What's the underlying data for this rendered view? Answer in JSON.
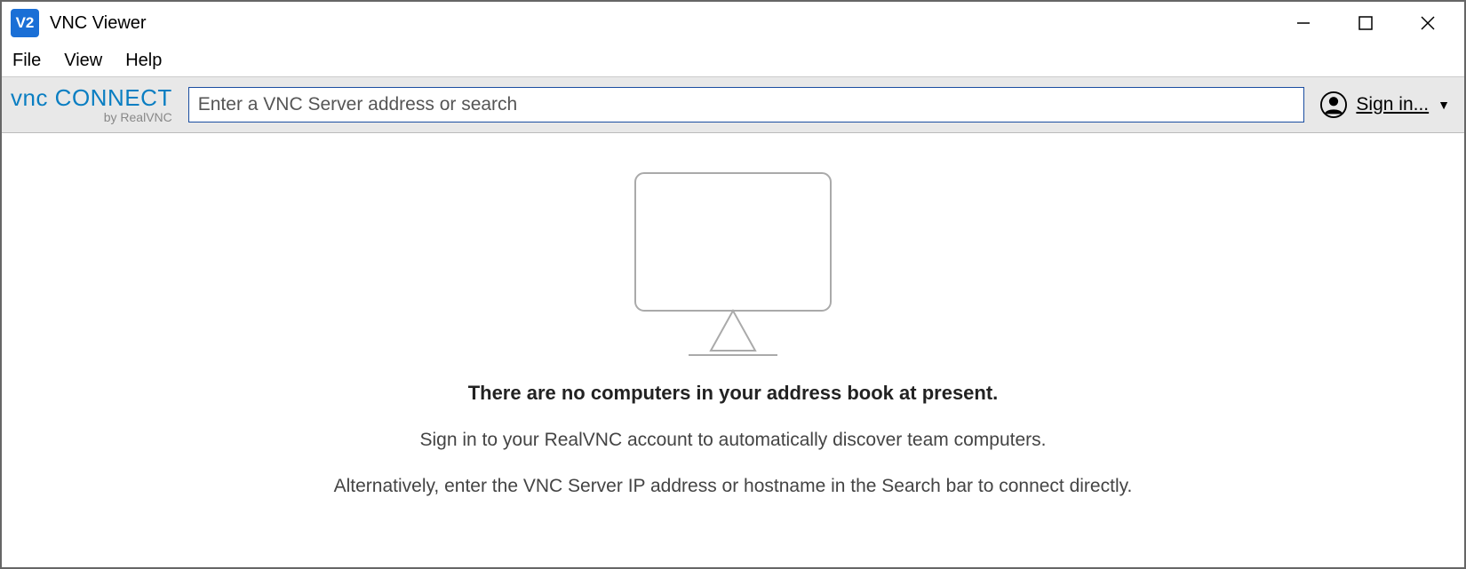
{
  "window": {
    "title": "VNC Viewer",
    "icon_text": "V2"
  },
  "menu": {
    "file": "File",
    "view": "View",
    "help": "Help"
  },
  "toolbar": {
    "brand_main": "vnc CONNECT",
    "brand_sub": "by RealVNC",
    "search_placeholder": "Enter a VNC Server address or search",
    "signin_label": "Sign in..."
  },
  "empty_state": {
    "heading": "There are no computers in your address book at present.",
    "line1": "Sign in to your RealVNC account to automatically discover team computers.",
    "line2": "Alternatively, enter the VNC Server IP address or hostname in the Search bar to connect directly."
  }
}
